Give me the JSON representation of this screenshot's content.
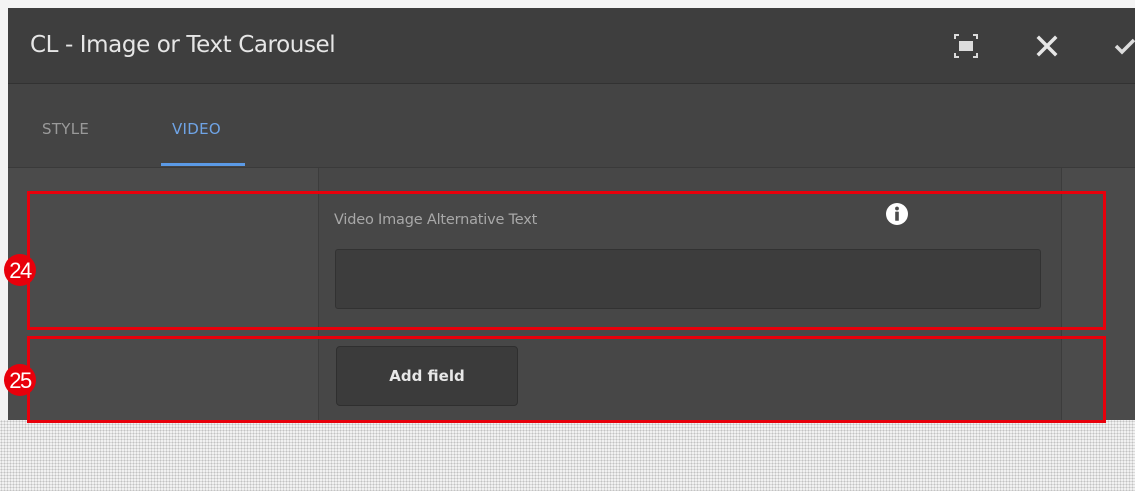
{
  "dialog": {
    "title": "CL - Image or Text Carousel",
    "controls": {
      "fullscreen_icon": "fullscreen-icon",
      "close_icon": "close-icon",
      "done_icon": "checkmark-icon"
    }
  },
  "tabs": [
    {
      "label": "STYLE",
      "active": false
    },
    {
      "label": "VIDEO",
      "active": true
    }
  ],
  "form": {
    "field_label": "Video Image Alternative Text",
    "field_value": "",
    "info_icon": "info-icon",
    "add_button_label": "Add field"
  },
  "annotations": [
    {
      "label": "24"
    },
    {
      "label": "25"
    }
  ],
  "colors": {
    "accent": "#5b9ae6",
    "annotation": "#e8000b",
    "dialog_bg": "#4b4b4b",
    "titlebar_bg": "#3e3e3e"
  }
}
